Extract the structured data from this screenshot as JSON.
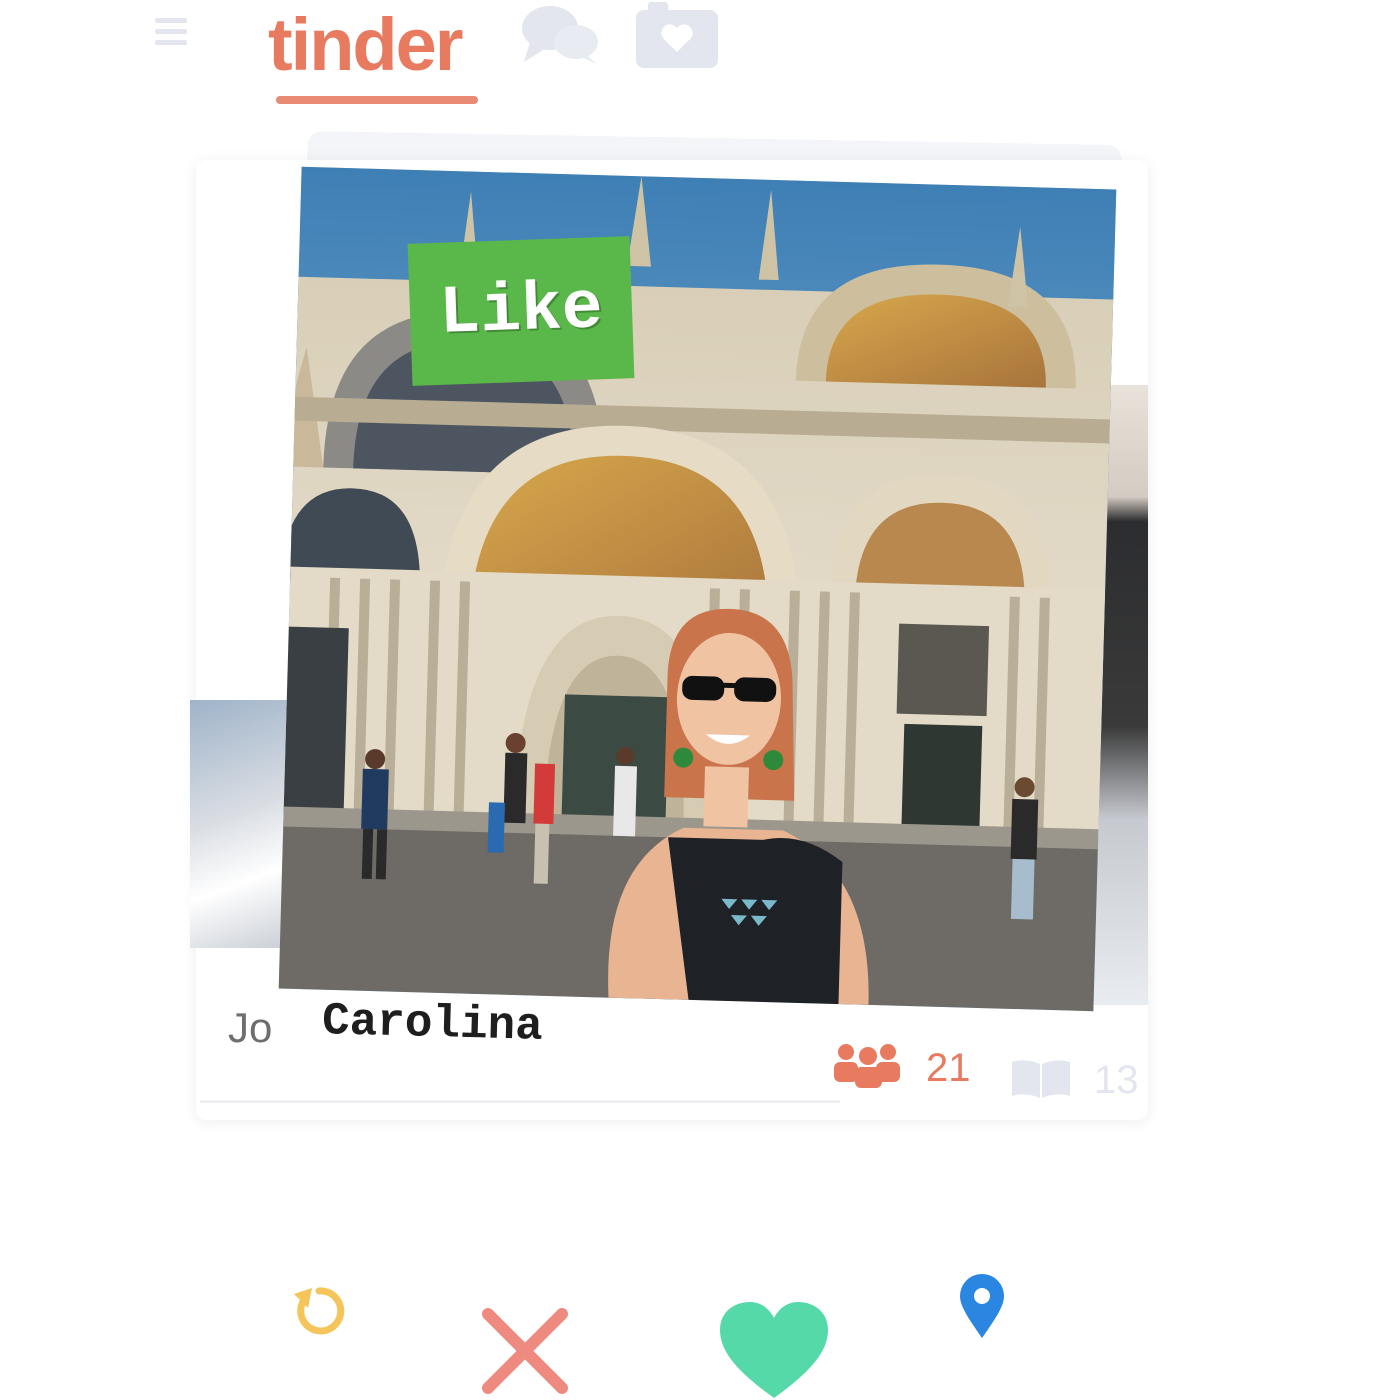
{
  "app": {
    "logo": "tinder",
    "icons": [
      "menu-icon",
      "chat-icon",
      "camera-icon"
    ]
  },
  "card": {
    "stamp": "Like",
    "name": "Carolina",
    "next_name_partial": "Jo",
    "friends_count": "21",
    "books_count": "13",
    "photo_description_icon": "photo"
  },
  "actions": {
    "icons": [
      "undo-icon",
      "close-icon",
      "heart-icon",
      "location-pin-icon"
    ]
  },
  "colors": {
    "brand": "#e87a5f",
    "stamp": "#5ab84a",
    "undo": "#f5c45a",
    "nope": "#ef8a80",
    "like": "#55d9a8",
    "location": "#2a86e0"
  }
}
